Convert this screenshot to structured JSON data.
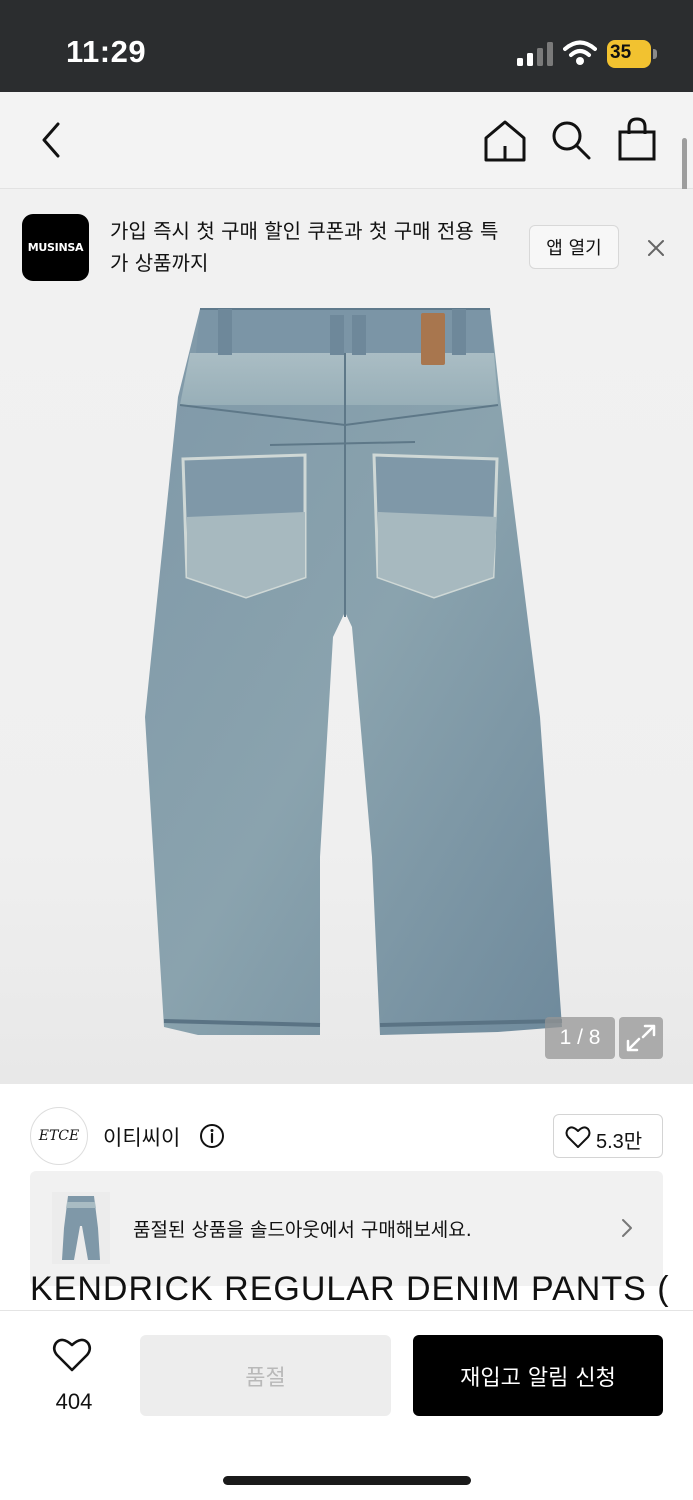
{
  "status_bar": {
    "time": "11:29",
    "battery": "35"
  },
  "header": {
    "icons": [
      "back-arrow-icon",
      "home-icon",
      "search-icon",
      "shopping-bag-icon"
    ]
  },
  "promo_banner": {
    "logo_text": "MUSINSA",
    "message": "가입 즉시 첫 구매 할인 쿠폰과 첫 구매 전용 특가 상품까지",
    "open_app_label": "앱 열기",
    "close_icon": "close-icon"
  },
  "gallery": {
    "counter": "1 / 8",
    "expand_icon": "expand-icon"
  },
  "brand": {
    "logo_text": "ETCE",
    "name": "이티씨이",
    "likes": "5.3만"
  },
  "soldout_notice": {
    "text": "품절된 상품을 솔드아웃에서 구매해보세요."
  },
  "product": {
    "title": "KENDRICK REGULAR DENIM PANTS (BLU"
  },
  "bottom_bar": {
    "wish_count": "404",
    "soldout_label": "품절",
    "restock_label": "재입고 알림 신청"
  },
  "colors": {
    "status_bar_bg": "#2b2d2f",
    "battery": "#f2c230",
    "primary_button": "#000000",
    "disabled_button": "#ededed"
  }
}
